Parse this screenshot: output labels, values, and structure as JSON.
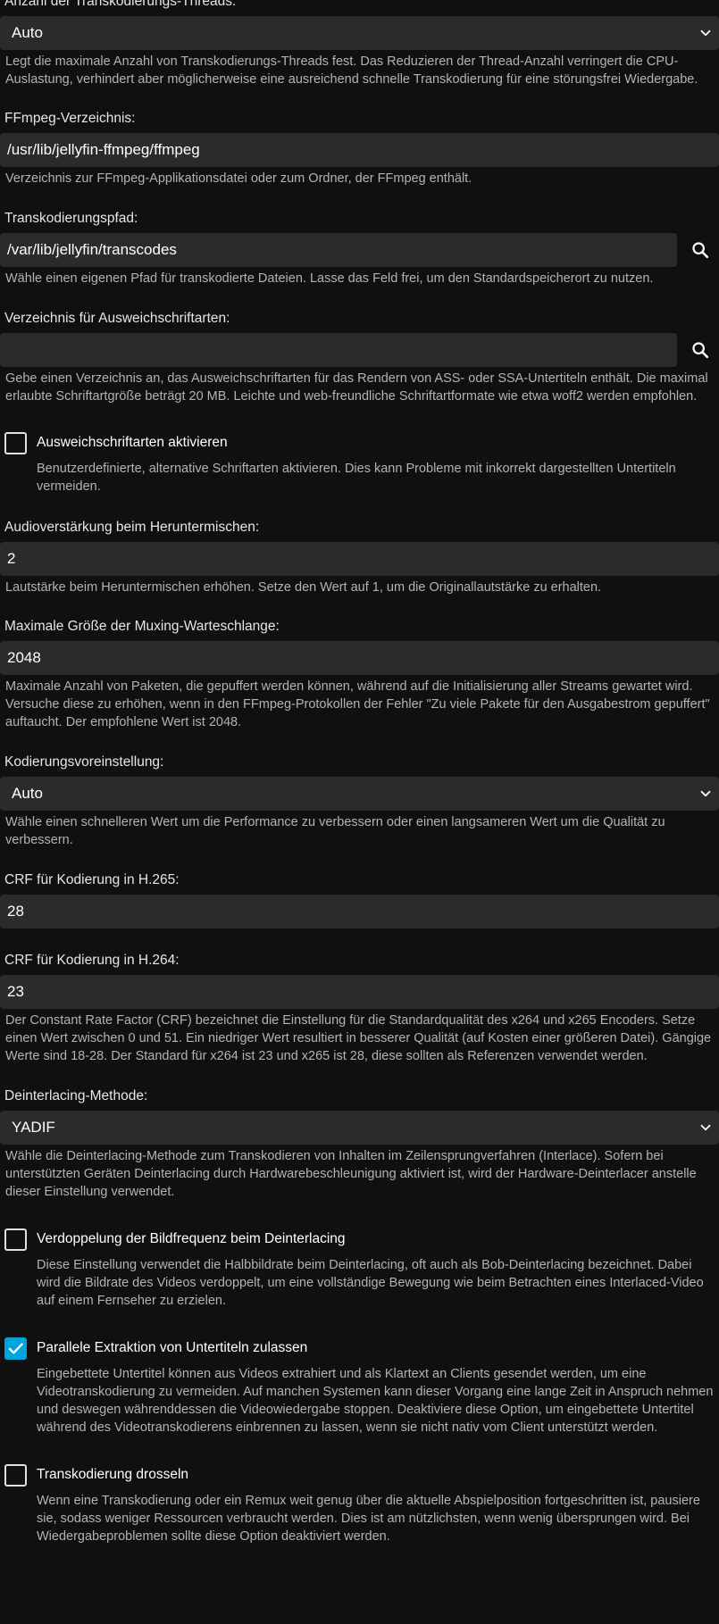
{
  "threads": {
    "label": "Anzahl der Transkodierungs-Threads:",
    "value": "Auto",
    "description": "Legt die maximale Anzahl von Transkodierungs-Threads fest. Das Reduzieren der Thread-Anzahl verringert die CPU-Auslastung, verhindert aber möglicherweise eine ausreichend schnelle Transkodierung für eine störungsfrei Wiedergabe."
  },
  "ffmpeg_path": {
    "label": "FFmpeg-Verzeichnis:",
    "value": "/usr/lib/jellyfin-ffmpeg/ffmpeg",
    "description": "Verzeichnis zur FFmpeg-Applikationsdatei oder zum Ordner, der FFmpeg enthält."
  },
  "transcode_path": {
    "label": "Transkodierungspfad:",
    "value": "/var/lib/jellyfin/transcodes",
    "description": "Wähle einen eigenen Pfad für transkodierte Dateien. Lasse das Feld frei, um den Standardspeicherort zu nutzen."
  },
  "fallback_fonts_path": {
    "label": "Verzeichnis für Ausweichschriftarten:",
    "value": "",
    "description": "Gebe einen Verzeichnis an, das Ausweichschriftarten für das Rendern von ASS- oder SSA-Untertiteln enthält. Die maximal erlaubte Schriftartgröße beträgt 20 MB. Leichte und web-freundliche Schriftartformate wie etwa woff2 werden empfohlen."
  },
  "fallback_fonts_enable": {
    "label": "Ausweichschriftarten aktivieren",
    "checked": false,
    "description": "Benutzerdefinierte, alternative Schriftarten aktivieren. Dies kann Probleme mit inkorrekt dargestellten Untertiteln vermeiden."
  },
  "downmix_boost": {
    "label": "Audioverstärkung beim Heruntermischen:",
    "value": "2",
    "description": "Lautstärke beim Heruntermischen erhöhen. Setze den Wert auf 1, um die Originallautstärke zu erhalten."
  },
  "muxing_queue": {
    "label": "Maximale Größe der Muxing-Warteschlange:",
    "value": "2048",
    "description": "Maximale Anzahl von Paketen, die gepuffert werden können, während auf die Initialisierung aller Streams gewartet wird. Versuche diese zu erhöhen, wenn in den FFmpeg-Protokollen der Fehler \"Zu viele Pakete für den Ausgabestrom gepuffert\" auftaucht. Der empfohlene Wert ist 2048."
  },
  "encoding_preset": {
    "label": "Kodierungsvoreinstellung:",
    "value": "Auto",
    "description": "Wähle einen schnelleren Wert um die Performance zu verbessern oder einen langsameren Wert um die Qualität zu verbessern."
  },
  "crf_h265": {
    "label": "CRF für Kodierung in H.265:",
    "value": "28"
  },
  "crf_h264": {
    "label": "CRF für Kodierung in H.264:",
    "value": "23",
    "description": "Der Constant Rate Factor (CRF) bezeichnet die Einstellung für die Standardqualität des x264 und x265 Encoders. Setze einen Wert zwischen 0 und 51. Ein niedriger Wert resultiert in besserer Qualität (auf Kosten einer größeren Datei). Gängige Werte sind 18-28. Der Standard für x264 ist 23 und x265 ist 28, diese sollten als Referenzen verwendet werden."
  },
  "deinterlace_method": {
    "label": "Deinterlacing-Methode:",
    "value": "YADIF",
    "description": "Wähle die Deinterlacing-Methode zum Transkodieren von Inhalten im Zeilensprungverfahren (Interlace). Sofern bei unterstützten Geräten Deinterlacing durch Hardwarebeschleunigung aktiviert ist, wird der Hardware-Deinterlacer anstelle dieser Einstellung verwendet."
  },
  "double_rate": {
    "label": "Verdoppelung der Bildfrequenz beim Deinterlacing",
    "checked": false,
    "description": "Diese Einstellung verwendet die Halbbildrate beim Deinterlacing, oft auch als Bob-Deinterlacing bezeichnet. Dabei wird die Bildrate des Videos verdoppelt, um eine vollständige Bewegung wie beim Betrachten eines Interlaced-Video auf einem Fernseher zu erzielen."
  },
  "subtitle_extraction": {
    "label": "Parallele Extraktion von Untertiteln zulassen",
    "checked": true,
    "description": "Eingebettete Untertitel können aus Videos extrahiert und als Klartext an Clients gesendet werden, um eine Videotranskodierung zu vermeiden. Auf manchen Systemen kann dieser Vorgang eine lange Zeit in Anspruch nehmen und deswegen währenddessen die Videowiedergabe stoppen. Deaktiviere diese Option, um eingebettete Untertitel während des Videotranskodierens einbrennen zu lassen, wenn sie nicht nativ vom Client unterstützt werden."
  },
  "throttle": {
    "label": "Transkodierung drosseln",
    "checked": false,
    "description": "Wenn eine Transkodierung oder ein Remux weit genug über die aktuelle Abspielposition fortgeschritten ist, pausiere sie, sodass weniger Ressourcen verbraucht werden. Dies ist am nützlichsten, wenn wenig übersprungen wird. Bei Wiedergabeproblemen sollte diese Option deaktiviert werden."
  },
  "colors": {
    "background": "#101010",
    "input": "#2b2b2b",
    "accent": "#00a4dc",
    "description_text": "#b3b3b3"
  }
}
